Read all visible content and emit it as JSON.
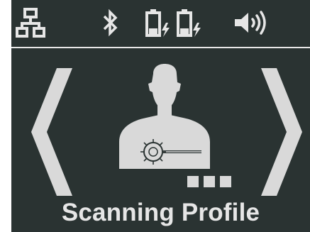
{
  "status_bar": {
    "icons": [
      "network-icon",
      "bluetooth-icon",
      "battery-charging-icon",
      "battery-charging-icon",
      "speaker-volume-icon"
    ]
  },
  "main": {
    "title": "Scanning Profile",
    "figure_icon": "person-scanner-icon",
    "nav": {
      "left_icon": "chevron-left-icon",
      "right_icon": "chevron-right-icon"
    },
    "page_indicator": {
      "count": 3
    }
  },
  "colors": {
    "background": "#2a3332",
    "foreground": "#e6e6e6",
    "figure": "#d9d9d9"
  }
}
